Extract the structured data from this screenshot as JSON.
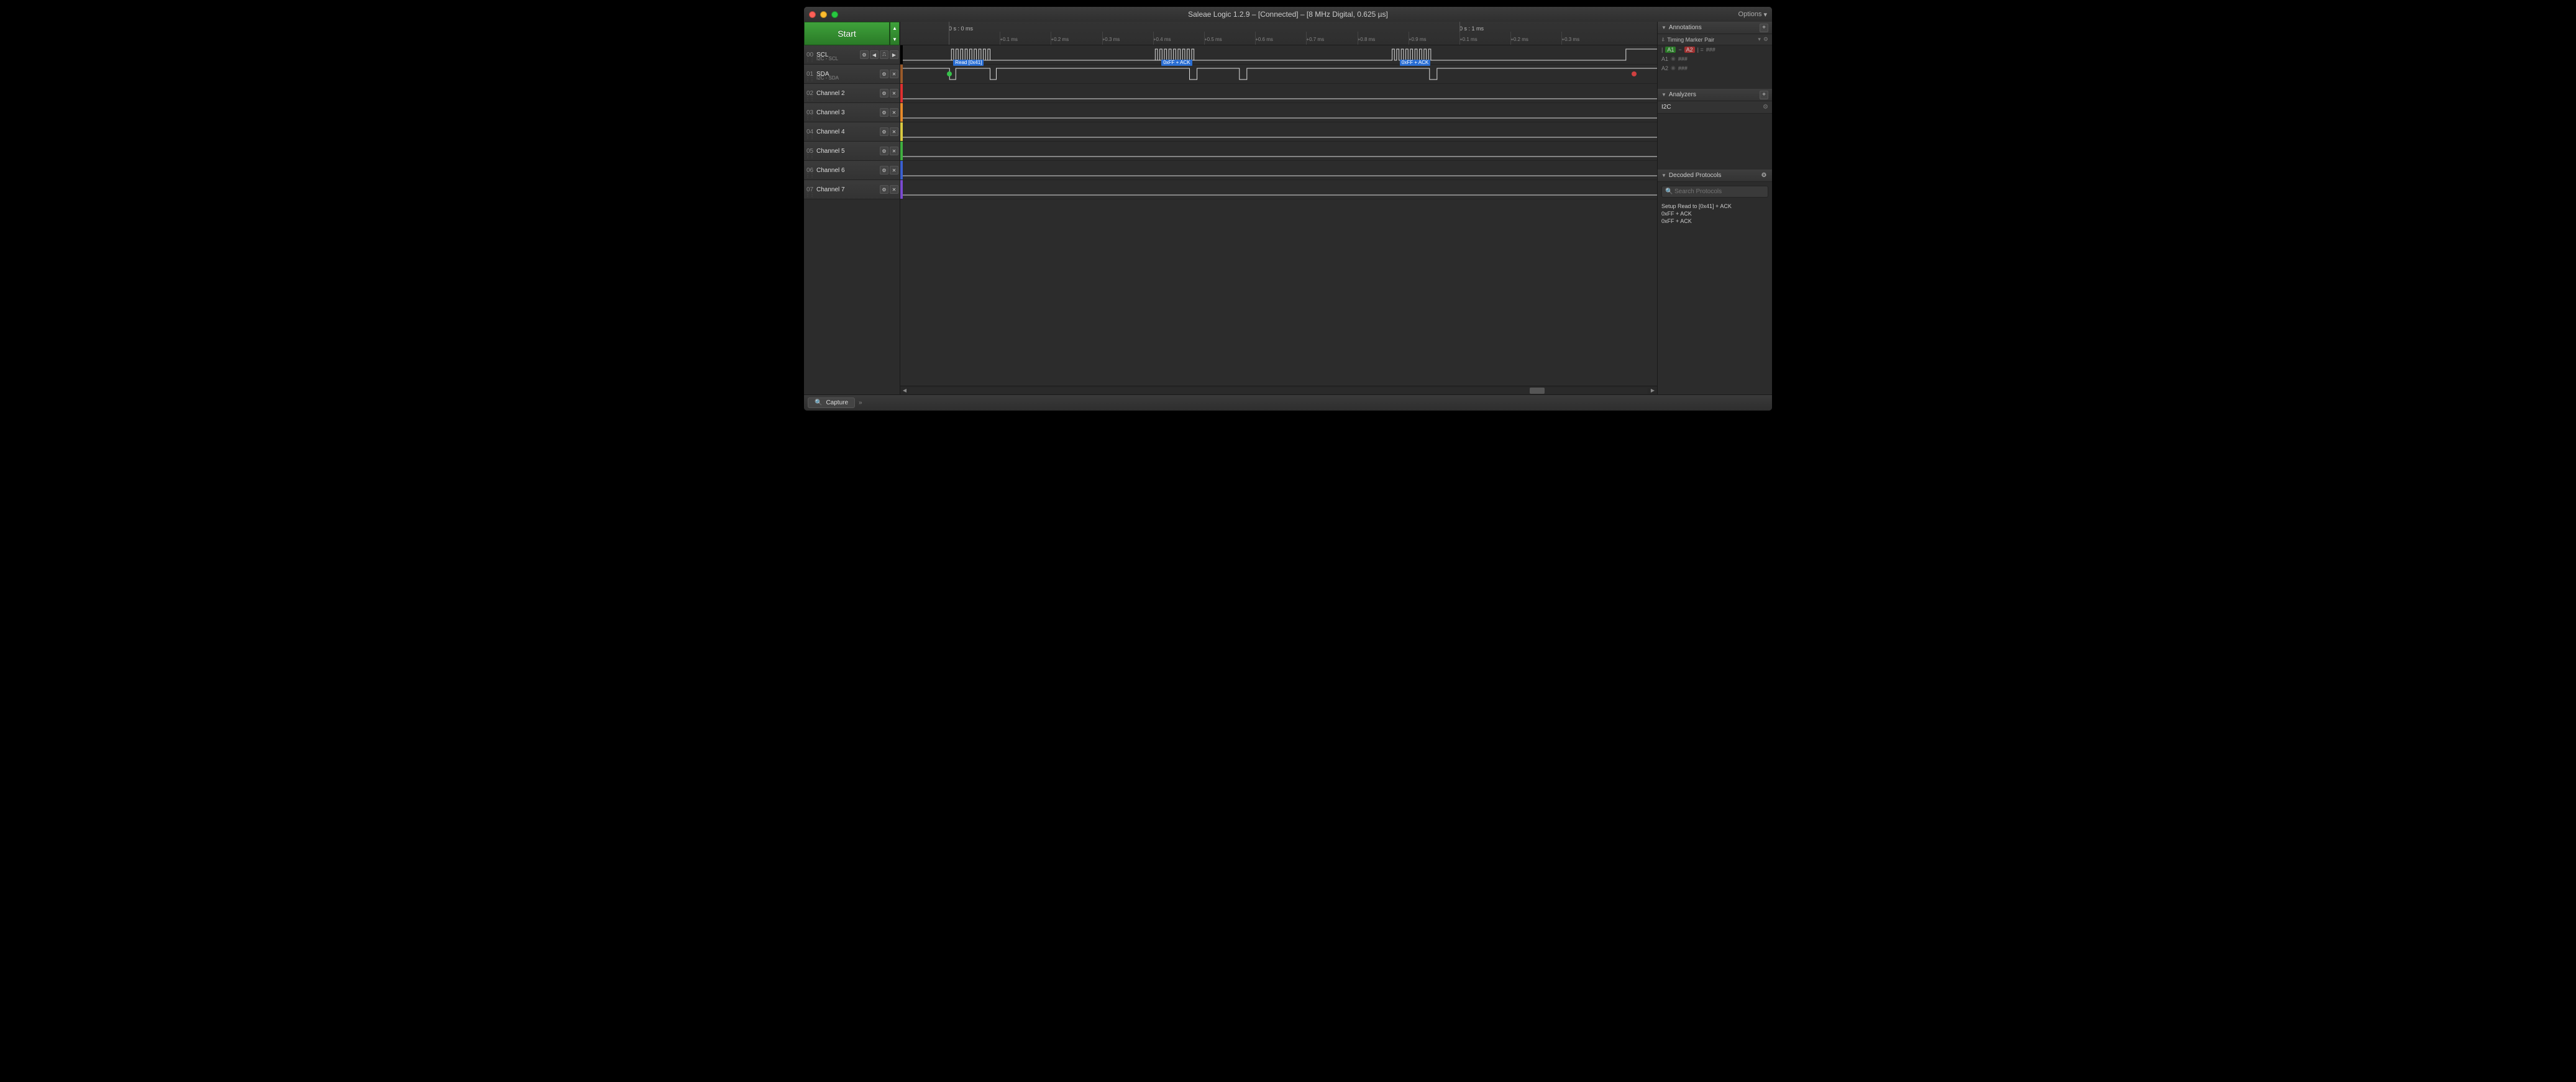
{
  "window": {
    "title": "Saleae Logic 1.2.9 – [Connected] – [8 MHz Digital, 0.625 µs]",
    "options_label": "Options"
  },
  "toolbar": {
    "start_label": "Start"
  },
  "ruler": {
    "origin_label": "0 s : 0 ms",
    "second_label": "0 s : 1 ms",
    "sub_ticks": [
      "+0.1 ms",
      "+0.2 ms",
      "+0.3 ms",
      "+0.4 ms",
      "+0.5 ms",
      "+0.6 ms",
      "+0.7 ms",
      "+0.8 ms",
      "+0.9 ms",
      "+0.1 ms",
      "+0.2 ms",
      "+0.3 ms"
    ]
  },
  "channels": [
    {
      "idx": "00",
      "name": "SCL",
      "sub": "I2C - SCL",
      "color": "#000000",
      "has_x": false,
      "has_nav": true
    },
    {
      "idx": "01",
      "name": "SDA",
      "sub": "I2C - SDA",
      "color": "#9a5a2a",
      "has_x": true,
      "has_nav": false
    },
    {
      "idx": "02",
      "name": "Channel 2",
      "sub": "",
      "color": "#e03030",
      "has_x": true,
      "has_nav": false
    },
    {
      "idx": "03",
      "name": "Channel 3",
      "sub": "",
      "color": "#e78a2a",
      "has_x": true,
      "has_nav": false
    },
    {
      "idx": "04",
      "name": "Channel 4",
      "sub": "",
      "color": "#d8c840",
      "has_x": true,
      "has_nav": false
    },
    {
      "idx": "05",
      "name": "Channel 5",
      "sub": "",
      "color": "#3fae3f",
      "has_x": true,
      "has_nav": false
    },
    {
      "idx": "06",
      "name": "Channel 6",
      "sub": "",
      "color": "#3a5fd0",
      "has_x": true,
      "has_nav": false
    },
    {
      "idx": "07",
      "name": "Channel 7",
      "sub": "",
      "color": "#7a4ad0",
      "has_x": true,
      "has_nav": false
    }
  ],
  "decodes": [
    {
      "text": "Read [0x41]",
      "left_pct": 7.0,
      "top_track": 1
    },
    {
      "text": "0xFF + ACK",
      "left_pct": 34.5,
      "top_track": 1
    },
    {
      "text": "0xFF + ACK",
      "left_pct": 66.0,
      "top_track": 1
    }
  ],
  "markers": {
    "a1_left_pct": 6.5,
    "a1_color": "#36c24a",
    "a2_left_pct": 97.0,
    "a2_color": "#d04040"
  },
  "annotations": {
    "title": "Annotations",
    "pair_label": "Timing Marker Pair",
    "expr": "| A1 − A2 | = ###",
    "a1_label": "A1",
    "a1_val": "###",
    "a2_label": "A2",
    "a2_val": "###"
  },
  "analyzers": {
    "title": "Analyzers",
    "items": [
      "I2C"
    ]
  },
  "decoded": {
    "title": "Decoded Protocols",
    "search_placeholder": "Search Protocols",
    "rows": [
      "Setup Read to [0x41] + ACK",
      "0xFF + ACK",
      "0xFF + ACK"
    ]
  },
  "tabs": {
    "capture": "Capture"
  },
  "scrollbar": {
    "thumb_left_pct": 84,
    "thumb_width_pct": 2
  }
}
